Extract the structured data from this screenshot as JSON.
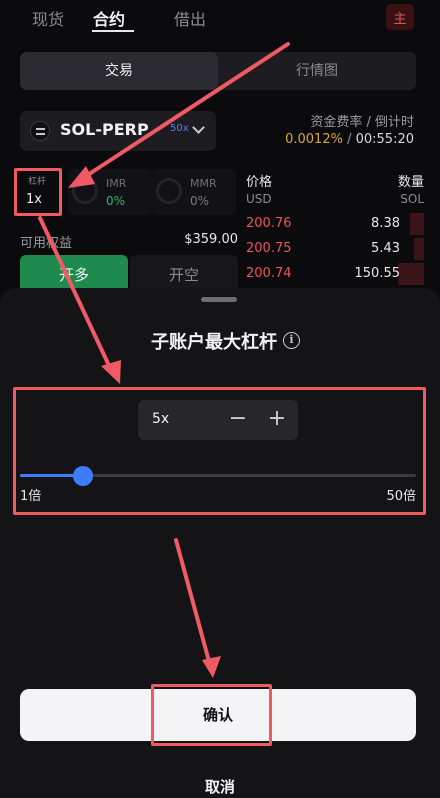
{
  "top_tabs": [
    {
      "label": "现货",
      "active": false
    },
    {
      "label": "合约",
      "active": true
    },
    {
      "label": "借出",
      "active": false
    }
  ],
  "corner_badge": "主",
  "segment": {
    "trade": "交易",
    "market": "行情图",
    "active": "trade"
  },
  "market": {
    "name": "SOL-PERP",
    "max_leverage": "50x"
  },
  "funding": {
    "label": "资金费率 / 倒计时",
    "rate": "0.0012%",
    "separator": " / ",
    "countdown": "00:55:20"
  },
  "leverage": {
    "label": "杠杆",
    "value": "1x"
  },
  "imr": {
    "label": "IMR",
    "value": "0%"
  },
  "mmr": {
    "label": "MMR",
    "value": "0%"
  },
  "equity": {
    "label": "可用权益",
    "value": "$359.00"
  },
  "buttons": {
    "long": "开多",
    "short": "开空"
  },
  "orderbook": {
    "price_header": "价格",
    "qty_header": "数量",
    "price_unit": "USD",
    "qty_unit": "SOL",
    "rows": [
      {
        "price": "200.76",
        "qty": "8.38"
      },
      {
        "price": "200.75",
        "qty": "5.43"
      },
      {
        "price": "200.74",
        "qty": "150.55"
      }
    ]
  },
  "sheet": {
    "title": "子账户最大杠杆",
    "stepper_value": "5x",
    "minus": "−",
    "plus": "+",
    "slider": {
      "min": 1,
      "max": 50,
      "value": 5,
      "min_label": "1倍",
      "max_label": "50倍"
    },
    "confirm": "确认",
    "cancel": "取消"
  },
  "colors": {
    "accent": "#3d7bff",
    "annotation": "#f05a64",
    "bid_green": "#1f8a4d",
    "ask_red": "#e85659",
    "funding_rate": "#d5a73a"
  }
}
